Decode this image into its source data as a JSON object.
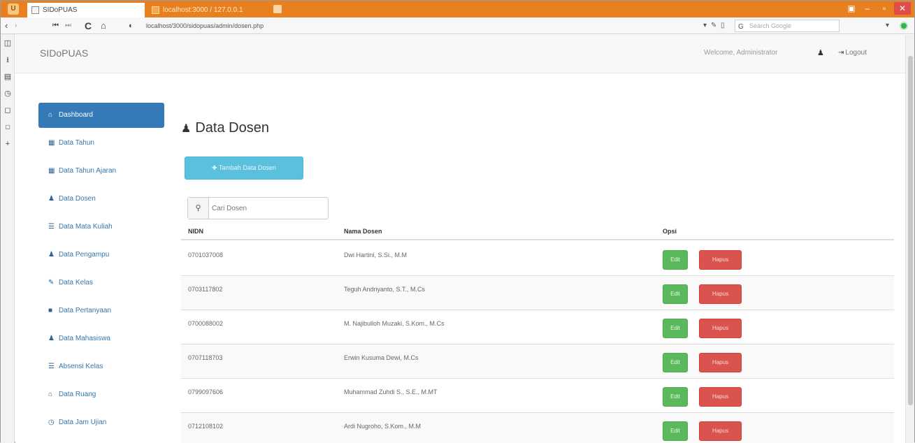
{
  "browser": {
    "tabs": [
      {
        "label": "SIDoPUAS"
      },
      {
        "label": "localhost:3000 / 127.0.0.1"
      }
    ],
    "address": "localhost/3000/sidopuas/admin/dosen.php",
    "search_placeholder": "Search Google"
  },
  "header": {
    "brand": "SIDoPUAS",
    "welcome": "Welcome, Administrator",
    "logout": "Logout"
  },
  "sidebar": {
    "items": [
      {
        "label": "Dashboard",
        "icon": "home-icon"
      },
      {
        "label": "Data Tahun",
        "icon": "table-icon"
      },
      {
        "label": "Data Tahun Ajaran",
        "icon": "table-icon"
      },
      {
        "label": "Data Dosen",
        "icon": "user-icon"
      },
      {
        "label": "Data Mata Kuliah",
        "icon": "list-icon"
      },
      {
        "label": "Data Pengampu",
        "icon": "user-icon"
      },
      {
        "label": "Data Kelas",
        "icon": "pencil-icon"
      },
      {
        "label": "Data Pertanyaan",
        "icon": "book-icon"
      },
      {
        "label": "Data Mahasiswa",
        "icon": "user-icon"
      },
      {
        "label": "Absensi Kelas",
        "icon": "list-icon"
      },
      {
        "label": "Data Ruang",
        "icon": "home-icon"
      },
      {
        "label": "Data Jam Ujian",
        "icon": "clock-icon"
      }
    ]
  },
  "main": {
    "title": "Data Dosen",
    "add_button": "Tambah Data Dosen",
    "search_placeholder": "Cari Dosen",
    "table": {
      "headers": [
        "NIDN",
        "Nama Dosen",
        "Opsi"
      ],
      "rows": [
        {
          "nidn": "0701037008",
          "nama": "Dwi Hartini, S.Si., M.M"
        },
        {
          "nidn": "0703117802",
          "nama": "Teguh Andriyanto, S.T., M.Cs"
        },
        {
          "nidn": "0700088002",
          "nama": "M. Najibulloh Muzaki, S.Kom., M.Cs"
        },
        {
          "nidn": "0707118703",
          "nama": "Erwin Kusuma Dewi, M.Cs"
        },
        {
          "nidn": "0799097606",
          "nama": "Muhammad Zuhdi S., S.E., M.MT"
        },
        {
          "nidn": "0712108102",
          "nama": "Ardi Nugroho, S.Kom., M.M"
        }
      ],
      "edit_label": "Edit",
      "delete_label": "Hapus"
    }
  },
  "colors": {
    "titlebar": "#e8801f",
    "primary": "#337ab7",
    "info": "#5bc0de",
    "success": "#5cb85c",
    "danger": "#d9534f"
  }
}
